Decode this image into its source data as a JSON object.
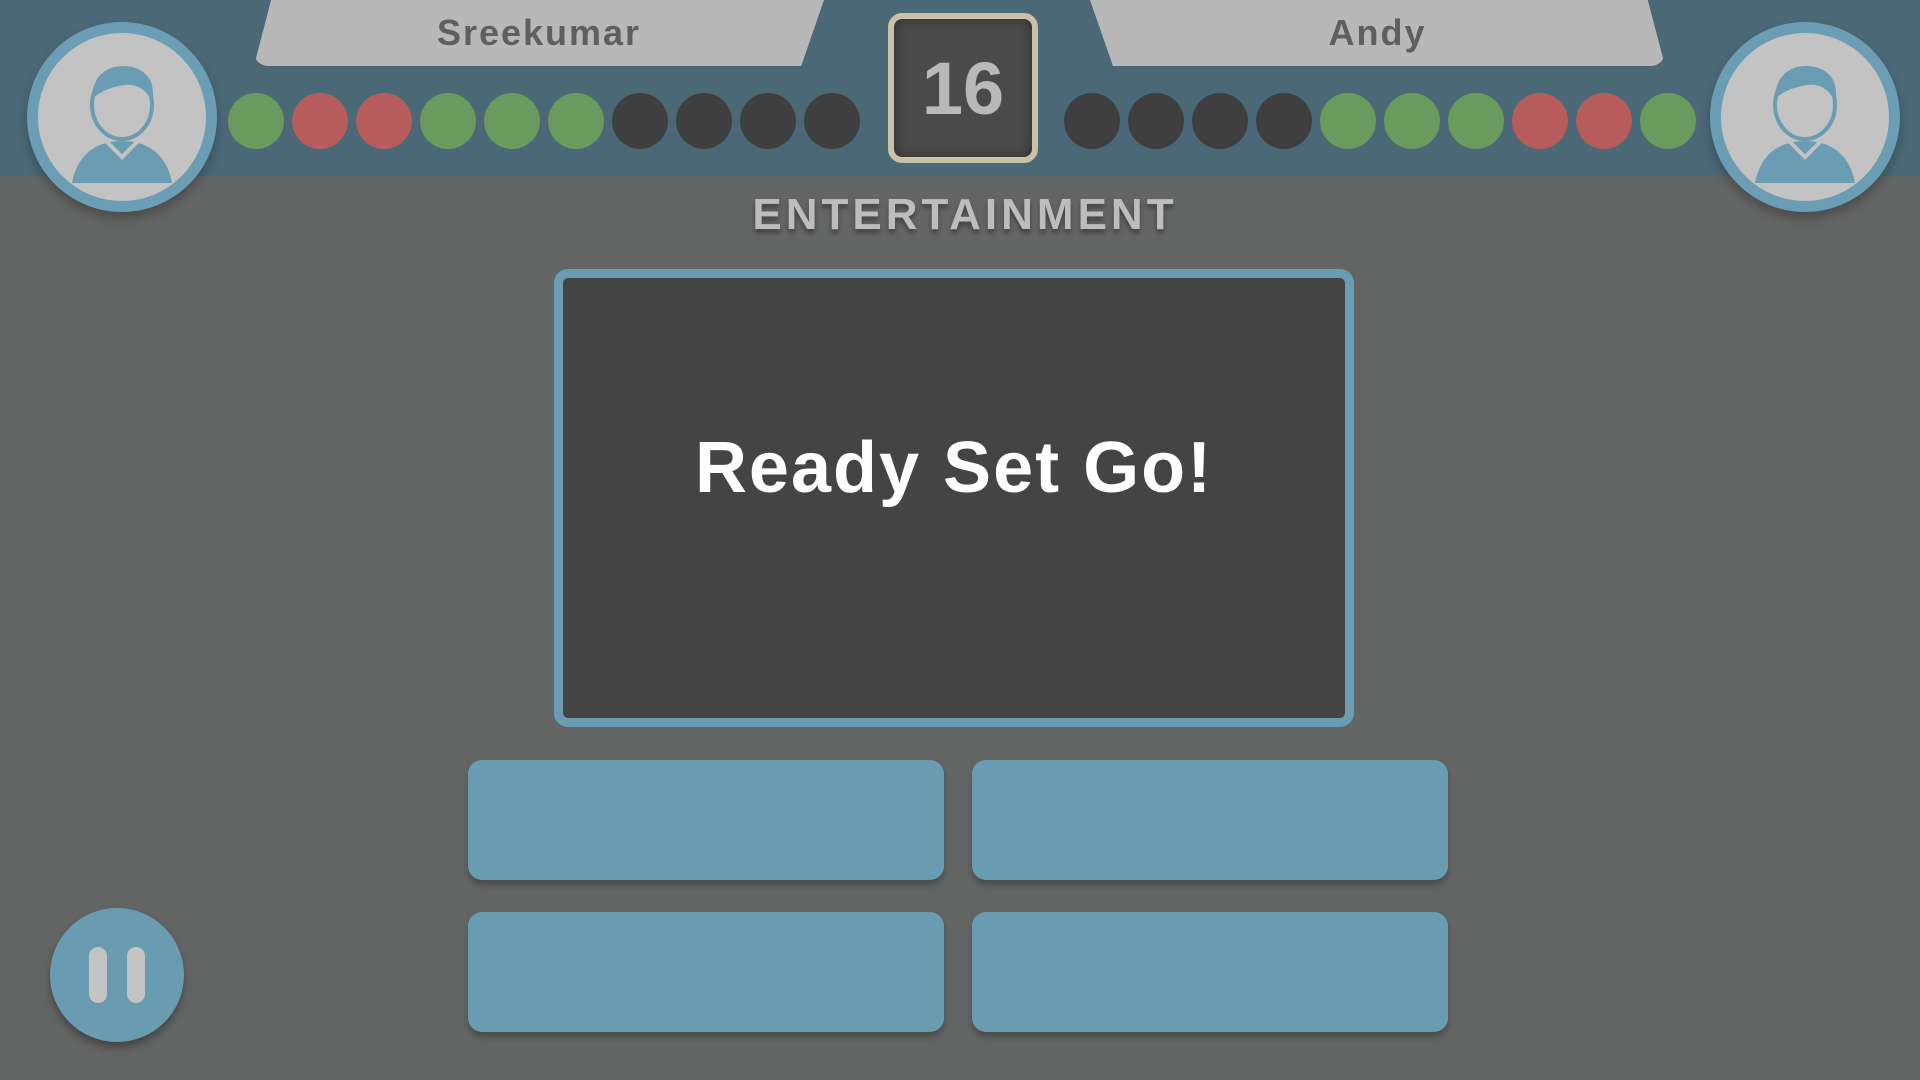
{
  "players": {
    "left": {
      "name": "Sreekumar",
      "progress": [
        "correct",
        "wrong",
        "wrong",
        "correct",
        "correct",
        "correct",
        "pending",
        "pending",
        "pending",
        "pending"
      ]
    },
    "right": {
      "name": "Andy",
      "progress": [
        "pending",
        "pending",
        "pending",
        "pending",
        "correct",
        "correct",
        "correct",
        "wrong",
        "wrong",
        "correct"
      ]
    }
  },
  "timer": "16",
  "category": "ENTERTAINMENT",
  "question": "Ready Set Go!",
  "answers": [
    "",
    "",
    "",
    ""
  ],
  "icons": {
    "avatar": "user-avatar-icon",
    "pause": "pause-icon"
  },
  "colors": {
    "correct": "#6a9a5d",
    "wrong": "#b75c5c",
    "pending": "#3f3f3f",
    "accent": "#6a9cb1",
    "topbar": "#4b6877",
    "background": "#636464"
  }
}
